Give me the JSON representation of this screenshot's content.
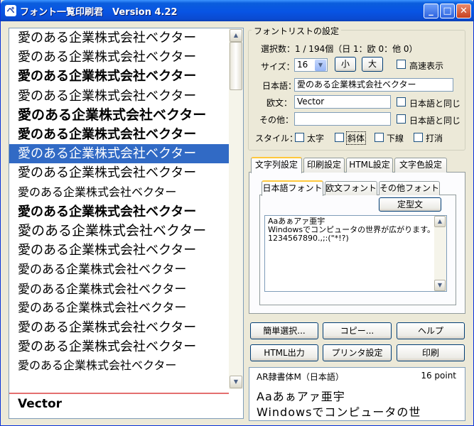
{
  "window": {
    "title": "フォント一覧印刷君　Version 4.22",
    "app_icon": "ペ",
    "controls": {
      "minimize": "_",
      "maximize": "□",
      "close": "✕"
    }
  },
  "font_list": {
    "items": [
      "愛のある企業株式会社ベクター",
      "愛のある企業株式会社ベクター",
      "愛のある企業株式会社ベクター",
      "愛のある企業株式会社ベクター",
      "愛のある企業株式会社ベクター",
      "愛のある企業株式会社ベクター",
      "愛のある企業株式会社ベクター",
      "愛のある企業株式会社ベクター",
      "愛のある企業株式会社ベクター",
      "愛のある企業株式会社ベクター",
      "愛のある企業株式会社ベクター",
      "愛のある企業株式会社ベクター",
      "愛のある企業株式会社ベクター",
      "愛のある企業株式会社ベクター",
      "愛のある企業株式会社ベクター",
      "愛のある企業株式会社ベクター",
      "愛のある企業株式会社ベクター",
      "愛のある企業株式会社ベクター"
    ],
    "selected_index": 6,
    "sample_word": "Vector"
  },
  "settings": {
    "group_title": "フォントリストの設定",
    "selection_count": "選択数：1 / 194個（日 1：欧 0：他 0）",
    "size_label": "サイズ：",
    "size_value": "16",
    "small_button": "小",
    "large_button": "大",
    "fast_display": "高速表示",
    "japanese_label": "日本語：",
    "japanese_value": "愛のある企業株式会社ベクター",
    "western_label": "欧文：",
    "western_value": "Vector",
    "same_as_japanese_1": "日本語と同じ",
    "other_label": "その他：",
    "other_value": "",
    "same_as_japanese_2": "日本語と同じ",
    "style_label": "スタイル：",
    "style_bold": "太字",
    "style_italic": "斜体",
    "style_underline": "下線",
    "style_strike": "打消"
  },
  "tabs": {
    "main": [
      "文字列設定",
      "印刷設定",
      "HTML設定",
      "文字色設定"
    ],
    "sub": [
      "日本語フォント",
      "欧文フォント",
      "その他フォント"
    ],
    "fixed_text_button": "定型文",
    "memo_lines": [
      "Aaあぁアァ亜宇",
      "Windowsでコンピュータの世界が広がります。",
      "1234567890.,;:(\"*!?)"
    ]
  },
  "buttons": {
    "simple_select": "簡単選択...",
    "copy": "コピー...",
    "help": "ヘルプ",
    "html_output": "HTML出力",
    "printer_settings": "プリンタ設定",
    "print": "印刷"
  },
  "preview": {
    "font_name": "AR隷書体M（日本語）",
    "size": "16 point",
    "line1": "Aaあぁアァ亜宇",
    "line2": "Windowsでコンピュータの世"
  },
  "colors": {
    "selection": "#316ac5",
    "titlebar": "#0854e4",
    "window_bg": "#ece9d8"
  }
}
